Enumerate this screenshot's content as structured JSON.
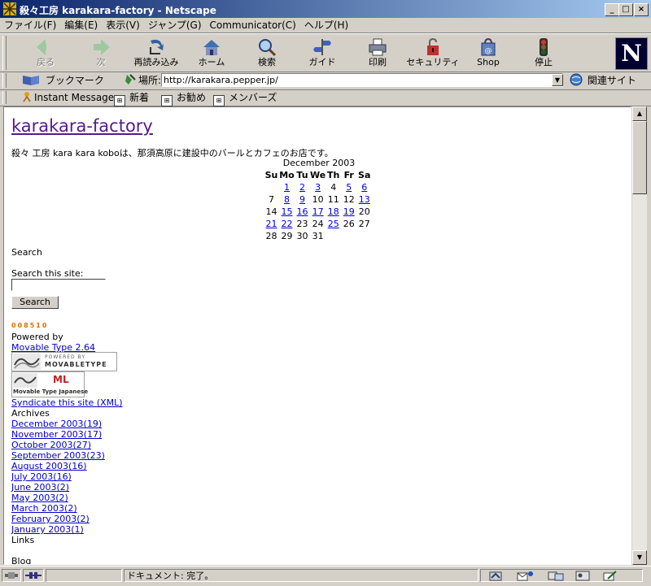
{
  "window": {
    "title": "殺々工房  karakara-factory - Netscape",
    "minimize": "_",
    "maximize": "□",
    "close": "×"
  },
  "menu": [
    "ファイル(F)",
    "編集(E)",
    "表示(V)",
    "ジャンプ(G)",
    "Communicator(C)",
    "ヘルプ(H)"
  ],
  "toolbar": {
    "back": "戻る",
    "forward": "次",
    "reload": "再読み込み",
    "home": "ホーム",
    "search": "検索",
    "guide": "ガイド",
    "print": "印刷",
    "security": "セキュリティ",
    "shop": "Shop",
    "stop": "停止",
    "logo": "N"
  },
  "location": {
    "bookmarks": "ブックマーク",
    "label": "場所:",
    "url": "http://karakara.pepper.jp/",
    "related": "関連サイト"
  },
  "personal": {
    "instant_message": "Instant Message",
    "new": "新着",
    "recommend": "お勧め",
    "members": "メンバーズ"
  },
  "page": {
    "site_title": "karakara-factory",
    "description": "殺々 工房 kara kara koboは、那須高原に建設中のバールとカフェのお店です。",
    "calendar": {
      "caption": "December 2003",
      "days": [
        "Su",
        "Mo",
        "Tu",
        "We",
        "Th",
        "Fr",
        "Sa"
      ],
      "weeks": [
        [
          "",
          "1",
          "2",
          "3",
          "4",
          "5",
          "6"
        ],
        [
          "7",
          "8",
          "9",
          "10",
          "11",
          "12",
          "13"
        ],
        [
          "14",
          "15",
          "16",
          "17",
          "18",
          "19",
          "20"
        ],
        [
          "21",
          "22",
          "23",
          "24",
          "25",
          "26",
          "27"
        ],
        [
          "28",
          "29",
          "30",
          "31",
          "",
          "",
          ""
        ]
      ],
      "linked": [
        "1",
        "2",
        "3",
        "5",
        "6",
        "8",
        "9",
        "13",
        "15",
        "16",
        "17",
        "18",
        "19",
        "21",
        "22",
        "25"
      ]
    },
    "search_heading": "Search",
    "search_label": "Search this site:",
    "search_value": "",
    "search_button": "Search",
    "counter": "008510",
    "powered_by": "Powered by",
    "mt_link": "Movable Type 2.64",
    "mt_badge_top": "POWERED BY",
    "mt_badge_bottom": "MOVABLETYPE",
    "mtj_badge_top": "ML",
    "mtj_badge_bottom": "Movable Type Japanese",
    "syndicate": "Syndicate this site (XML)",
    "archives_heading": "Archives",
    "archives": [
      "December 2003(19)",
      "November 2003(17)",
      "October 2003(27)",
      "September 2003(23)",
      "August 2003(16)",
      "July 2003(16)",
      "June 2003(2)",
      "May 2003(2)",
      "March 2003(2)",
      "February 2003(2)",
      "January 2003(1)"
    ],
    "links_heading": "Links",
    "blog_heading": "Blog"
  },
  "status": {
    "text": "ドキュメント: 完了。"
  },
  "colors": {
    "titlebar_start": "#0a246a",
    "titlebar_end": "#a6caf0",
    "chrome": "#d4d0c8",
    "link": "#0000cc",
    "visited": "#551a8b",
    "counter": "#e07000"
  }
}
